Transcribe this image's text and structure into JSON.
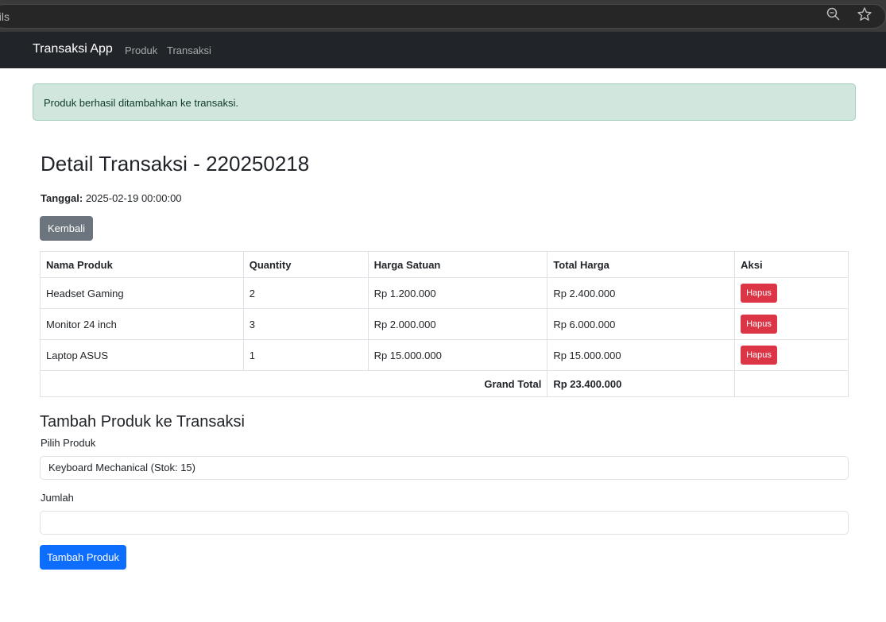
{
  "browser": {
    "url_fragment": "ails",
    "zoom_icon": "magnifier-icon",
    "bookmark_icon": "star-icon"
  },
  "navbar": {
    "brand": "Transaksi App",
    "links": [
      "Produk",
      "Transaksi"
    ]
  },
  "alert": {
    "text": "Produk berhasil ditambahkan ke transaksi.",
    "color": "#d1e7dd"
  },
  "detail": {
    "title": "Detail Transaksi - 220250218",
    "date_label": "Tanggal:",
    "date_value": "2025-02-19 00:00:00",
    "back_label": "Kembali"
  },
  "table": {
    "headers": [
      "Nama Produk",
      "Quantity",
      "Harga Satuan",
      "Total Harga",
      "Aksi"
    ],
    "rows": [
      {
        "name": "Headset Gaming",
        "qty": "2",
        "price": "Rp 1.200.000",
        "total": "Rp 2.400.000",
        "action": "Hapus"
      },
      {
        "name": "Monitor 24 inch",
        "qty": "3",
        "price": "Rp 2.000.000",
        "total": "Rp 6.000.000",
        "action": "Hapus"
      },
      {
        "name": "Laptop ASUS",
        "qty": "1",
        "price": "Rp 15.000.000",
        "total": "Rp 15.000.000",
        "action": "Hapus"
      }
    ],
    "grand_total_label": "Grand Total",
    "grand_total_value": "Rp 23.400.000"
  },
  "form": {
    "title": "Tambah Produk ke Transaksi",
    "product_label": "Pilih Produk",
    "product_selected": "Keyboard Mechanical (Stok: 15)",
    "qty_label": "Jumlah",
    "qty_value": "",
    "submit_label": "Tambah Produk"
  },
  "colors": {
    "navbar": "#212529",
    "danger": "#dc3545",
    "primary": "#0d6efd",
    "secondary": "#6c757d"
  }
}
